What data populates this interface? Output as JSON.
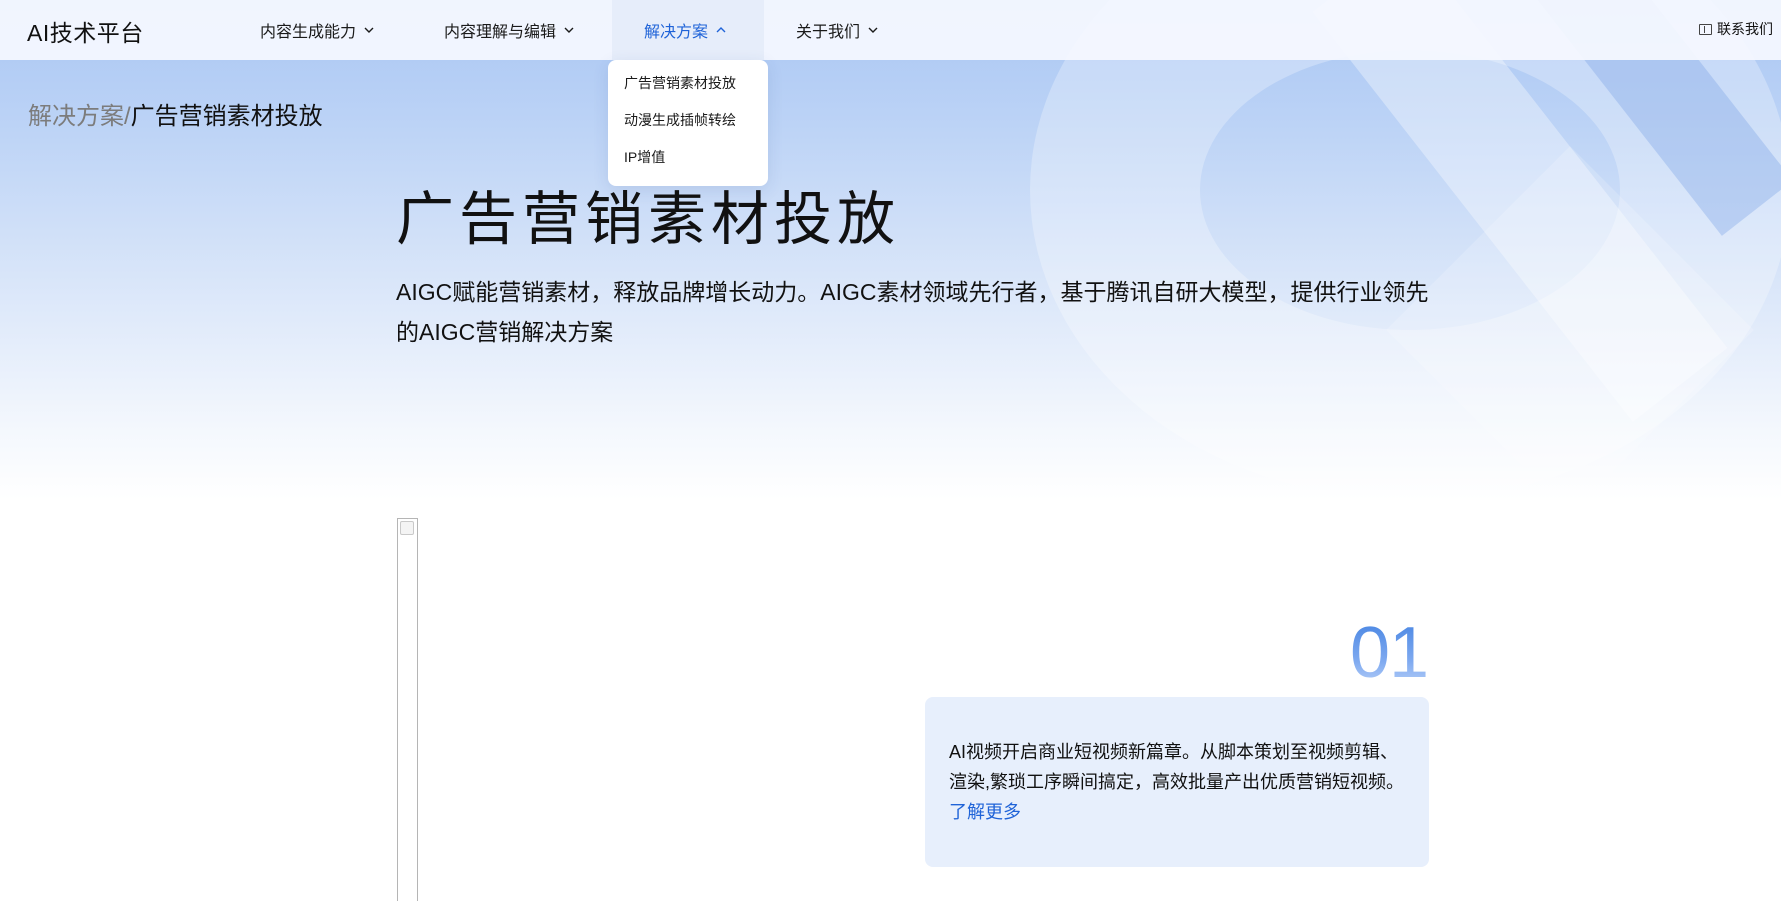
{
  "nav": {
    "logo": "AI技术平台",
    "items": [
      {
        "label": "内容生成能力"
      },
      {
        "label": "内容理解与编辑"
      },
      {
        "label": "解决方案"
      },
      {
        "label": "关于我们"
      }
    ],
    "contact": "联系我们",
    "accent_color": "#1f63d8"
  },
  "dropdown": {
    "items": [
      "广告营销素材投放",
      "动漫生成插帧转绘",
      "IP增值"
    ]
  },
  "breadcrumb": {
    "parent": "解决方案",
    "separator": "/",
    "current": "广告营销素材投放"
  },
  "hero": {
    "title": "广告营销素材投放",
    "description": "AIGC赋能营销素材，释放品牌增长动力。AIGC素材领域先行者，基于腾讯自研大模型，提供行业领先的AIGC营销解决方案"
  },
  "feature": {
    "number": "01",
    "text": "AI视频开启商业短视频新篇章。从脚本策划至视频剪辑、渲染,繁琐工序瞬间搞定，高效批量产出优质营销短视频。",
    "link": "了解更多"
  }
}
